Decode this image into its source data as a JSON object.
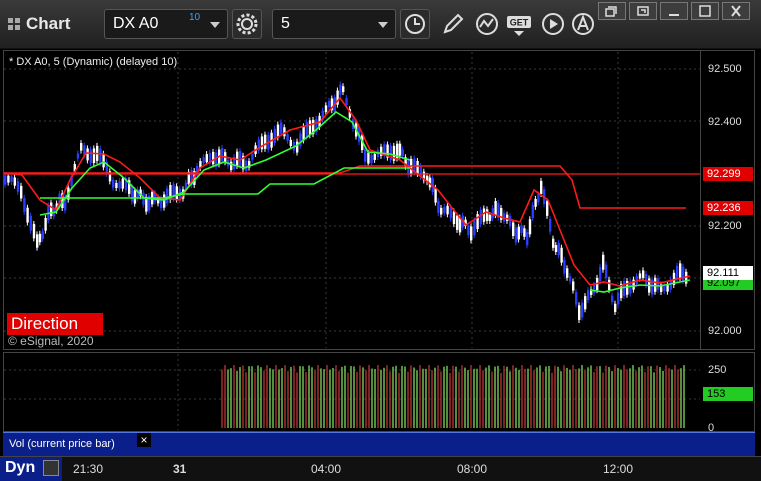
{
  "window": {
    "title": "Chart",
    "symbol": "DX A0",
    "symbol_badge": "10",
    "interval": "5",
    "get_label": "GET",
    "controls": [
      "restore-icon",
      "maximize-icon",
      "close-icon"
    ]
  },
  "chart": {
    "description": "* DX A0, 5 (Dynamic) (delayed 10)",
    "study_label": "Direction",
    "copyright": "© eSignal, 2020",
    "price_ticks": [
      "92.500",
      "92.400",
      "92.300",
      "92.200",
      "92.100",
      "92.000"
    ],
    "tags": {
      "red_upper": "92.299",
      "red_lower": "92.236",
      "price_last": "92.111",
      "green": "92.097"
    },
    "colors": {
      "red_line": "#ff1a1a",
      "green_line": "#33ff33",
      "candle_up": "#ffffff",
      "candle_down": "#2a3cff",
      "tag_red": "#e00000",
      "tag_green": "#22cc22"
    }
  },
  "volume": {
    "legend": "Vol (current price bar)",
    "ticks": [
      "250",
      "0"
    ],
    "current": "153"
  },
  "time_axis": {
    "mode": "Dyn",
    "labels": [
      "21:30",
      "31",
      "04:00",
      "08:00",
      "12:00"
    ]
  }
}
